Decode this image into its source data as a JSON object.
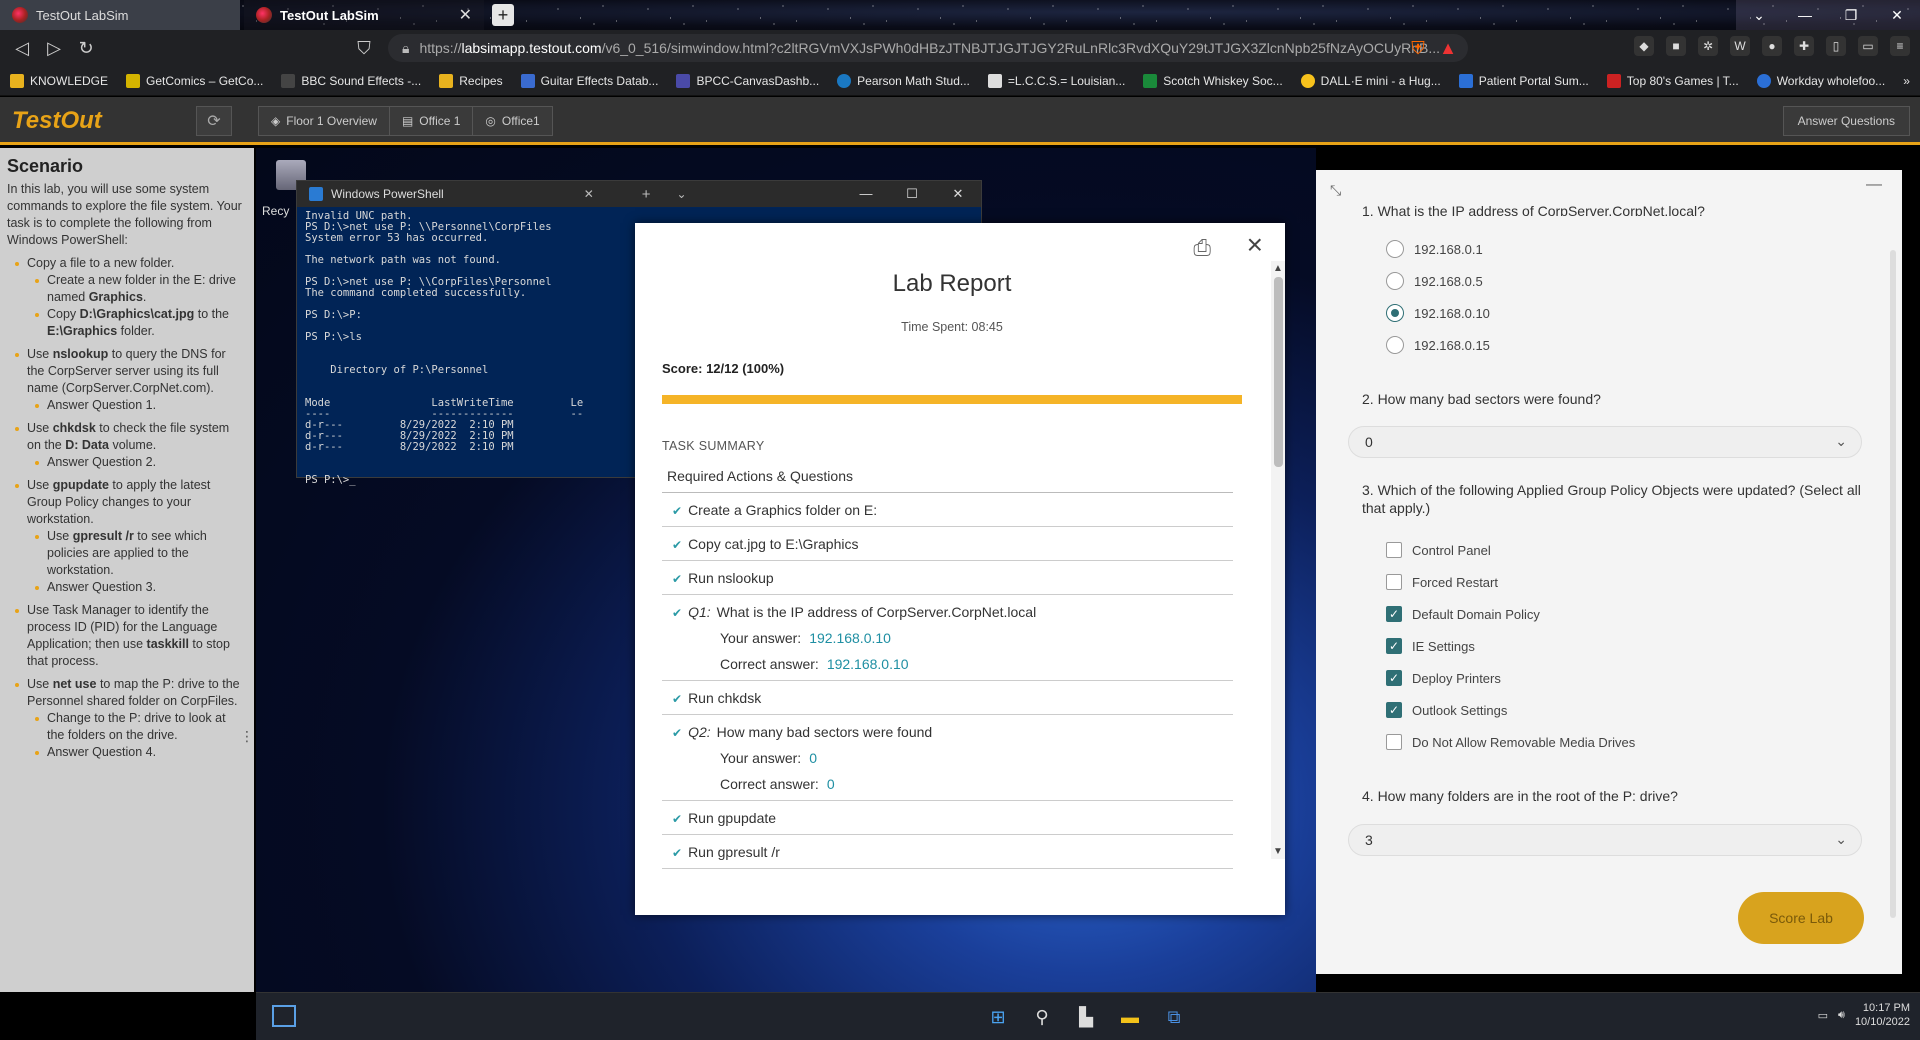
{
  "browser": {
    "tabs": [
      {
        "label": "TestOut LabSim",
        "active": false
      },
      {
        "label": "TestOut LabSim",
        "active": true
      }
    ],
    "new_tab": "+",
    "url_host": "labsimapp.testout.com",
    "url_prefix": "https://",
    "url_path": "/v6_0_516/simwindow.html?c2ltRGVmVXJsPWh0dHBzJTNBJTJGJTJGY2RuLnRlc3RvdXQuY29tJTJGX3ZlcnNpb25fNzAyOCUyRnB...",
    "bookmarks": [
      "KNOWLEDGE",
      "GetComics – GetCo...",
      "BBC Sound Effects -...",
      "Recipes",
      "Guitar Effects Datab...",
      "BPCC-CanvasDashb...",
      "Pearson Math Stud...",
      "=L.C.C.S.= Louisian...",
      "Scotch Whiskey Soc...",
      "DALL·E mini - a Hug...",
      "Patient Portal Sum...",
      "Top 80's Games | T...",
      "Workday wholefoo..."
    ],
    "bookmark_more": "»"
  },
  "appbar": {
    "logo": "TestOut",
    "breadcrumbs": [
      "Floor 1 Overview",
      "Office 1",
      "Office1"
    ],
    "answer_button": "Answer Questions"
  },
  "scenario": {
    "title": "Scenario",
    "intro": "In this lab, you will use some system commands to explore the file system. Your task is to complete the following from Windows PowerShell:"
  },
  "desktop": {
    "recycle_label": "Recy",
    "powershell": {
      "title": "Windows PowerShell",
      "lines": [
        "Invalid UNC path.",
        "PS D:\\>net use P: \\\\Personnel\\CorpFiles",
        "System error 53 has occurred.",
        "",
        "The network path was not found.",
        "",
        "PS D:\\>net use P: \\\\CorpFiles\\Personnel",
        "The command completed successfully.",
        "",
        "PS D:\\>P:",
        "",
        "PS P:\\>ls",
        "",
        "",
        "    Directory of P:\\Personnel",
        "",
        "",
        "Mode                LastWriteTime         Le",
        "----                -------------         --",
        "d-r---         8/29/2022  2:10 PM",
        "d-r---         8/29/2022  2:10 PM",
        "d-r---         8/29/2022  2:10 PM",
        "",
        "",
        "PS P:\\>_"
      ]
    }
  },
  "report": {
    "title": "Lab Report",
    "time_spent": "Time Spent: 08:45",
    "score": "Score: 12/12 (100%)",
    "progress_fraction": 1.0,
    "task_summary": "TASK SUMMARY",
    "required_header": "Required Actions & Questions",
    "tasks": [
      {
        "label": "Create a Graphics folder on E:"
      },
      {
        "label": "Copy cat.jpg to E:\\Graphics"
      },
      {
        "label": "Run nslookup"
      },
      {
        "q": "Q1:",
        "label": "What is the IP address of CorpServer.CorpNet.local",
        "your_label": "Your answer:",
        "your": "192.168.0.10",
        "correct_label": "Correct answer:",
        "correct": "192.168.0.10"
      },
      {
        "label": "Run chkdsk"
      },
      {
        "q": "Q2:",
        "label": "How many bad sectors were found",
        "your_label": "Your answer:",
        "your": "0",
        "correct_label": "Correct answer:",
        "correct": "0"
      },
      {
        "label": "Run gpupdate"
      },
      {
        "label": "Run gpresult /r"
      }
    ]
  },
  "questions": {
    "q1_title": "1. What is the IP address of CorpServer.CorpNet.local?",
    "q1_options": [
      {
        "label": "192.168.0.1",
        "selected": false
      },
      {
        "label": "192.168.0.5",
        "selected": false
      },
      {
        "label": "192.168.0.10",
        "selected": true
      },
      {
        "label": "192.168.0.15",
        "selected": false
      }
    ],
    "q2_title": "2. How many bad sectors were found?",
    "q2_value": "0",
    "q3_title": "3. Which of the following Applied Group Policy Objects were updated? (Select all that apply.)",
    "q3_options": [
      {
        "label": "Control Panel",
        "checked": false
      },
      {
        "label": "Forced Restart",
        "checked": false
      },
      {
        "label": "Default Domain Policy",
        "checked": true
      },
      {
        "label": "IE Settings",
        "checked": true
      },
      {
        "label": "Deploy Printers",
        "checked": true
      },
      {
        "label": "Outlook Settings",
        "checked": true
      },
      {
        "label": "Do Not Allow Removable Media Drives",
        "checked": false
      }
    ],
    "q4_title": "4. How many folders are in the root of the P: drive?",
    "q4_value": "3",
    "score_button": "Score Lab"
  },
  "taskbar": {
    "time": "10:17 PM",
    "date": "10/10/2022"
  }
}
